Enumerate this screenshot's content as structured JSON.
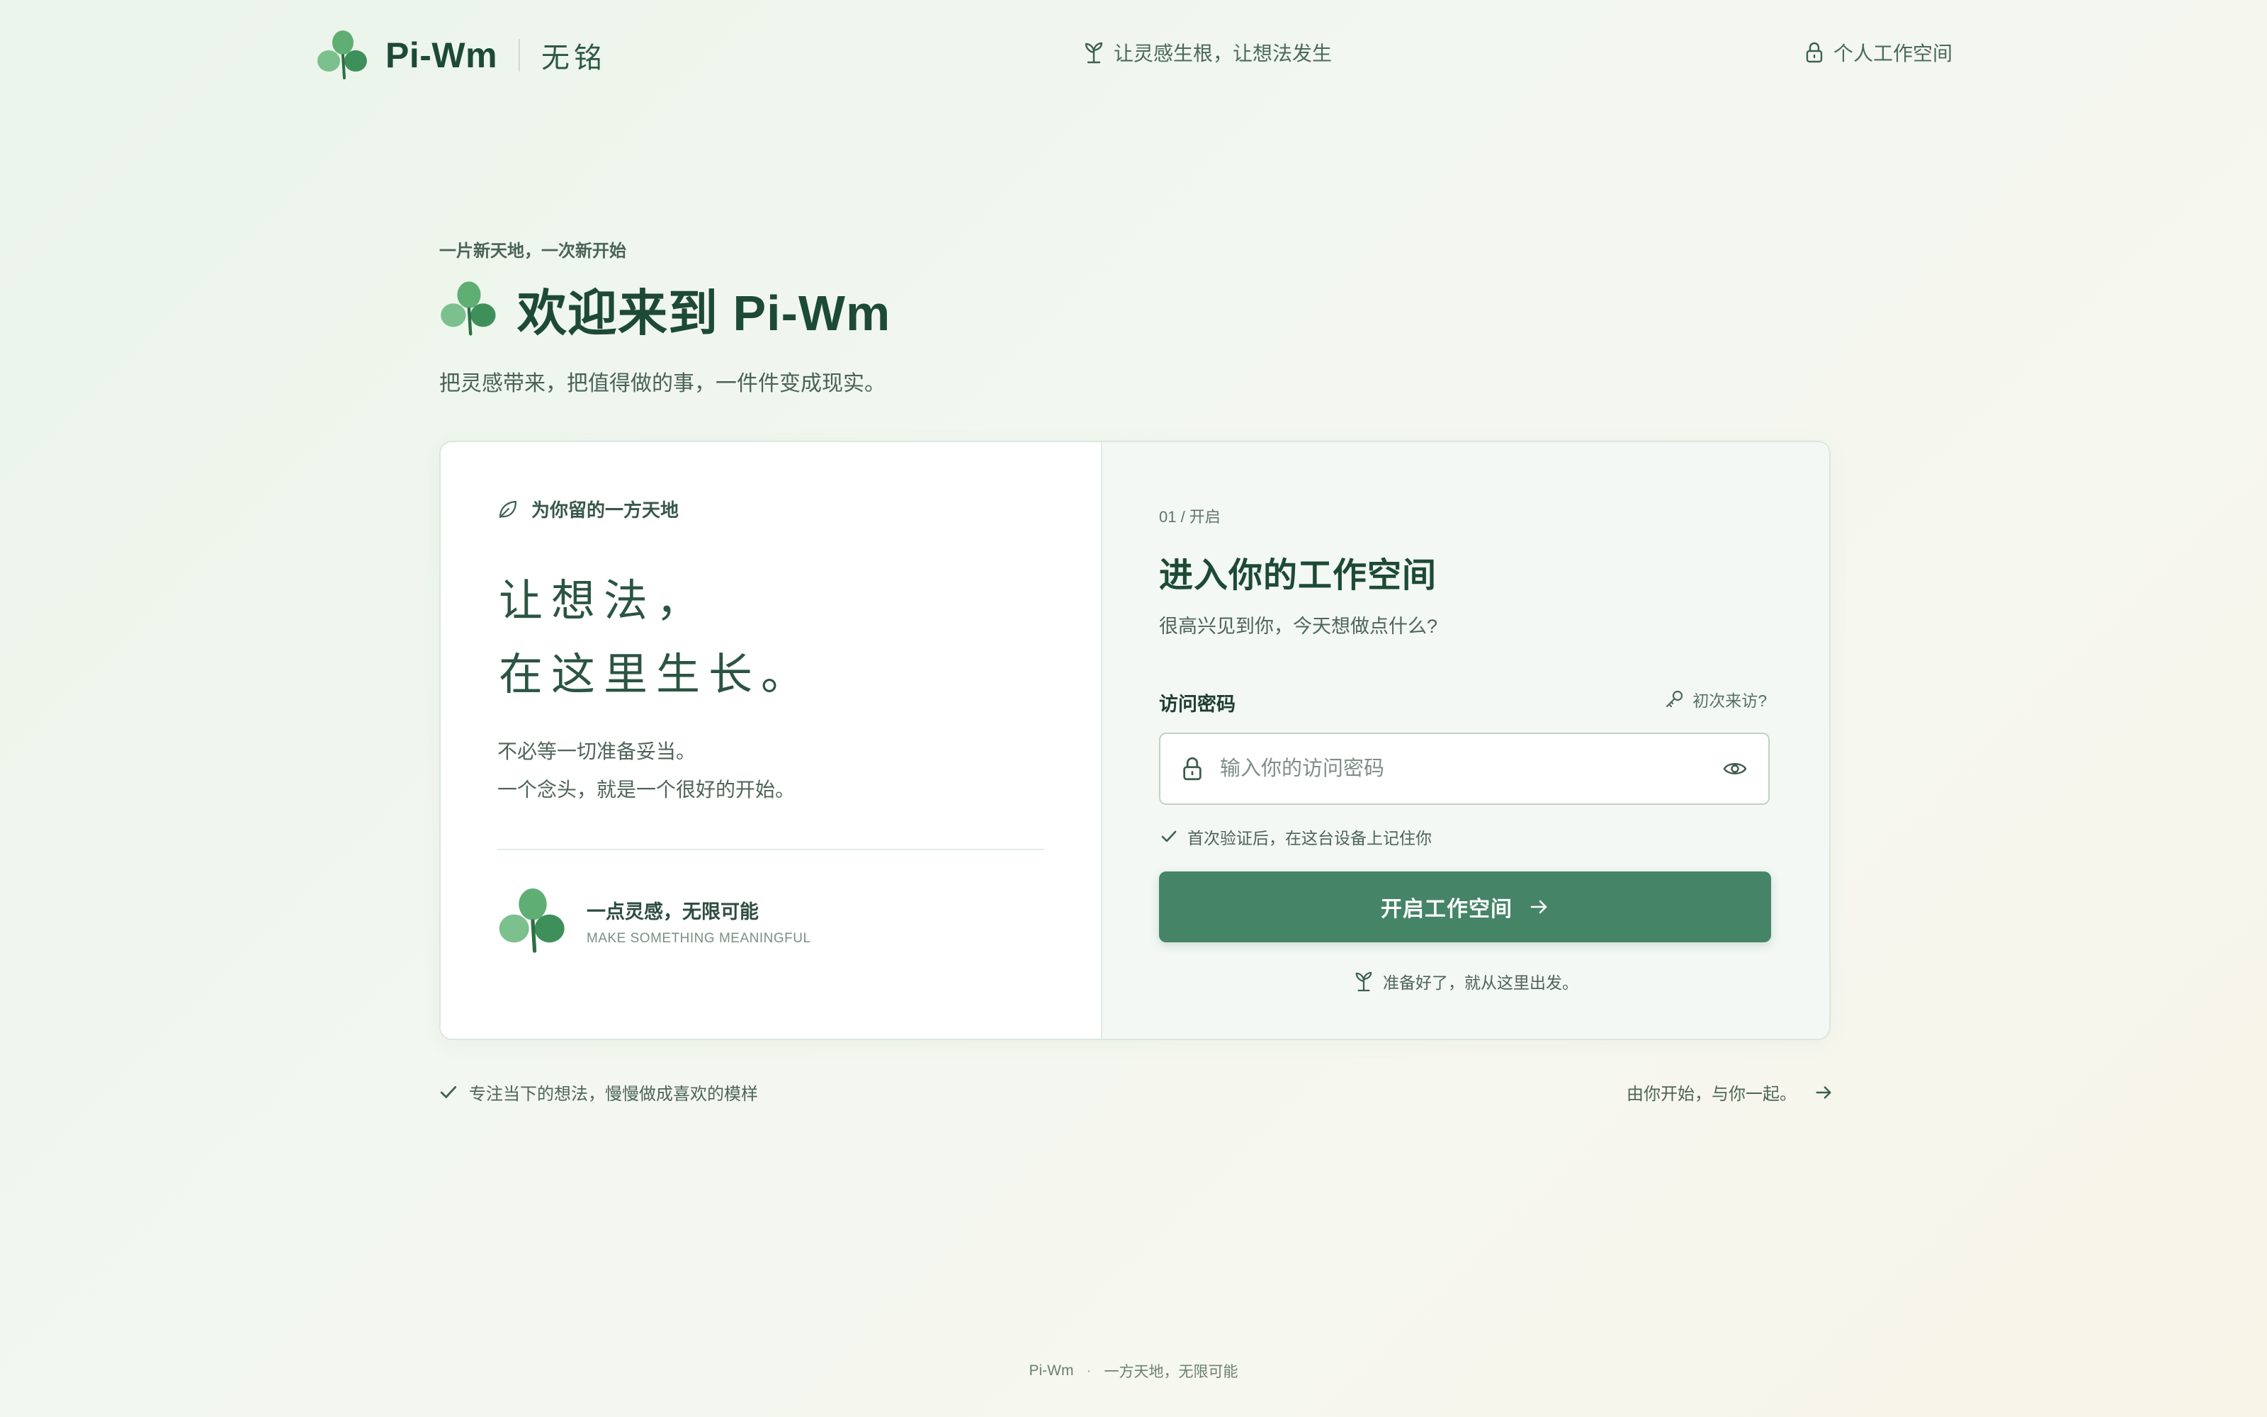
{
  "header": {
    "brand": "Pi-Wm",
    "brand_cn": "无铭",
    "tagline": "让灵感生根，让想法发生",
    "workspace_link": "个人工作空间"
  },
  "hero": {
    "eyebrow": "一片新天地，一次新开始",
    "title": "欢迎来到 Pi-Wm",
    "subtitle": "把灵感带来，把值得做的事，一件件变成现实。"
  },
  "left_panel": {
    "heading": "为你留的一方天地",
    "poem_line1": "让想法，",
    "poem_line2": "在这里生长。",
    "text_line1": "不必等一切准备妥当。",
    "text_line2": "一个念头，就是一个很好的开始。",
    "footer_title": "一点灵感，无限可能",
    "footer_subtitle": "MAKE SOMETHING MEANINGFUL"
  },
  "right_panel": {
    "step": "01 / 开启",
    "title": "进入你的工作空间",
    "subtitle": "很高兴见到你，今天想做点什么?",
    "password_label": "访问密码",
    "first_visit": "初次来访?",
    "password_placeholder": "输入你的访问密码",
    "password_value": "",
    "remember": "首次验证后，在这台设备上记住你",
    "submit": "开启工作空间",
    "ready": "准备好了，就从这里出发。"
  },
  "bottom": {
    "focus": "专注当下的想法，慢慢做成喜欢的模样",
    "start": "由你开始，与你一起。"
  },
  "footer": {
    "brand": "Pi-Wm",
    "separator": "·",
    "text": "一方天地，无限可能"
  },
  "colors": {
    "primary": "#468468",
    "brand_text": "#1d4a34",
    "clover_light": "#7cc08e",
    "clover_dark": "#3f8f5a"
  }
}
